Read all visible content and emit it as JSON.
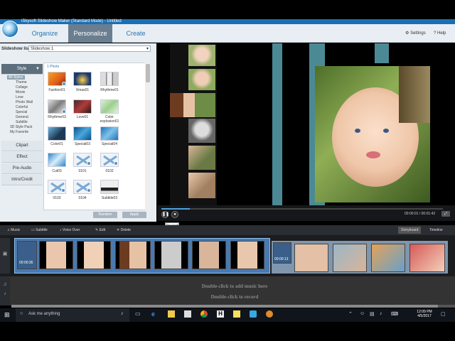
{
  "app": {
    "title": "iSkysoft Slideshow Maker (Standard Mode) - Untitled"
  },
  "nav": {
    "tabs": [
      {
        "label": "Organize"
      },
      {
        "label": "Personalize"
      },
      {
        "label": "Create"
      }
    ],
    "settings_label": "Settings",
    "help_label": "Help"
  },
  "slideshow_list": {
    "label": "Slideshow list :",
    "value": "Slideshow 1"
  },
  "categories": [
    {
      "label": "Style"
    },
    {
      "label": "Clipart"
    },
    {
      "label": "Effect"
    },
    {
      "label": "Pre-Audio"
    },
    {
      "label": "Intro/Credit"
    }
  ],
  "style_subitems": [
    "All Styles",
    "Theme",
    "Collage",
    "Movie",
    "Love",
    "Photo Wall",
    "Colorful",
    "Special",
    "General",
    "Subtitle",
    "3D Style Pack",
    "My Favorite"
  ],
  "grid": {
    "header": "1 Photo",
    "tiles": [
      {
        "label": "Fashion01"
      },
      {
        "label": "Xmas01"
      },
      {
        "label": "Rhythme01"
      },
      {
        "label": "Rhythme03"
      },
      {
        "label": "Love01"
      },
      {
        "label": "Color explosion01"
      },
      {
        "label": "Color01"
      },
      {
        "label": "Special03"
      },
      {
        "label": "Special04"
      },
      {
        "label": "Cut03"
      },
      {
        "label": "0101"
      },
      {
        "label": "0102"
      },
      {
        "label": "0103"
      },
      {
        "label": "0104"
      },
      {
        "label": "Subtitle03"
      }
    ],
    "random_label": "Random",
    "apply_label": "Apply"
  },
  "player": {
    "time": "00:00:01 / 00:01:42",
    "tooltip": "Paused",
    "progress": 0.1
  },
  "timeline_toolbar": {
    "music": "Music",
    "subtitle": "Subtitle",
    "voiceover": "Voice Over",
    "edit": "Edit",
    "delete": "Delete",
    "storyboard": "Storyboard",
    "timeline": "Timeline"
  },
  "timeline": {
    "clip1_time": "00:00:36",
    "clip2_time": "00:00:13",
    "music_hint": "Double-click to add music here",
    "record_hint": "Double-click to record"
  },
  "taskbar": {
    "search_placeholder": "Ask me anything",
    "time": "12:09 PM",
    "date": "4/5/2017"
  },
  "colors": {
    "title_blue": "#1a6fb4",
    "active_tab": "#6a7e8f",
    "accent_blue": "#2a76b3",
    "teal_bar": "#4b8a95",
    "taskbar": "#10151b"
  }
}
